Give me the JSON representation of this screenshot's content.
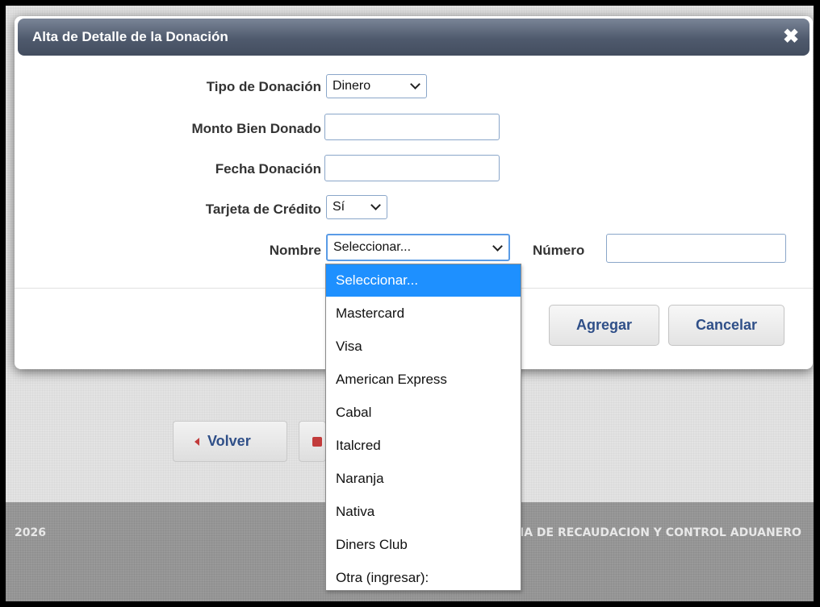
{
  "background": {
    "back_button": "Volver",
    "footer_year": "2026",
    "footer_org": "IA DE RECAUDACIÓN Y CONTROL ADUANERO"
  },
  "dialog": {
    "title": "Alta de Detalle de la Donación",
    "fields": {
      "tipo_label": "Tipo de Donación",
      "tipo_value": "Dinero",
      "monto_label": "Monto Bien Donado",
      "monto_value": "",
      "fecha_label": "Fecha Donación",
      "fecha_value": "",
      "tarjeta_label": "Tarjeta de Crédito",
      "tarjeta_value": "Sí",
      "nombre_label": "Nombre",
      "nombre_value": "Seleccionar...",
      "numero_label": "Número",
      "numero_value": ""
    },
    "buttons": {
      "agregar": "Agregar",
      "cancelar": "Cancelar"
    }
  },
  "dropdown": {
    "options": [
      "Seleccionar...",
      "Mastercard",
      "Visa",
      "American Express",
      "Cabal",
      "Italcred",
      "Naranja",
      "Nativa",
      "Diners Club",
      "Otra (ingresar):"
    ],
    "selected_index": 0
  },
  "colors": {
    "titlebar": "#4f5a6d",
    "accent_blue": "#1e90ff",
    "button_text": "#2f4f88",
    "input_border": "#8aa6c9"
  }
}
